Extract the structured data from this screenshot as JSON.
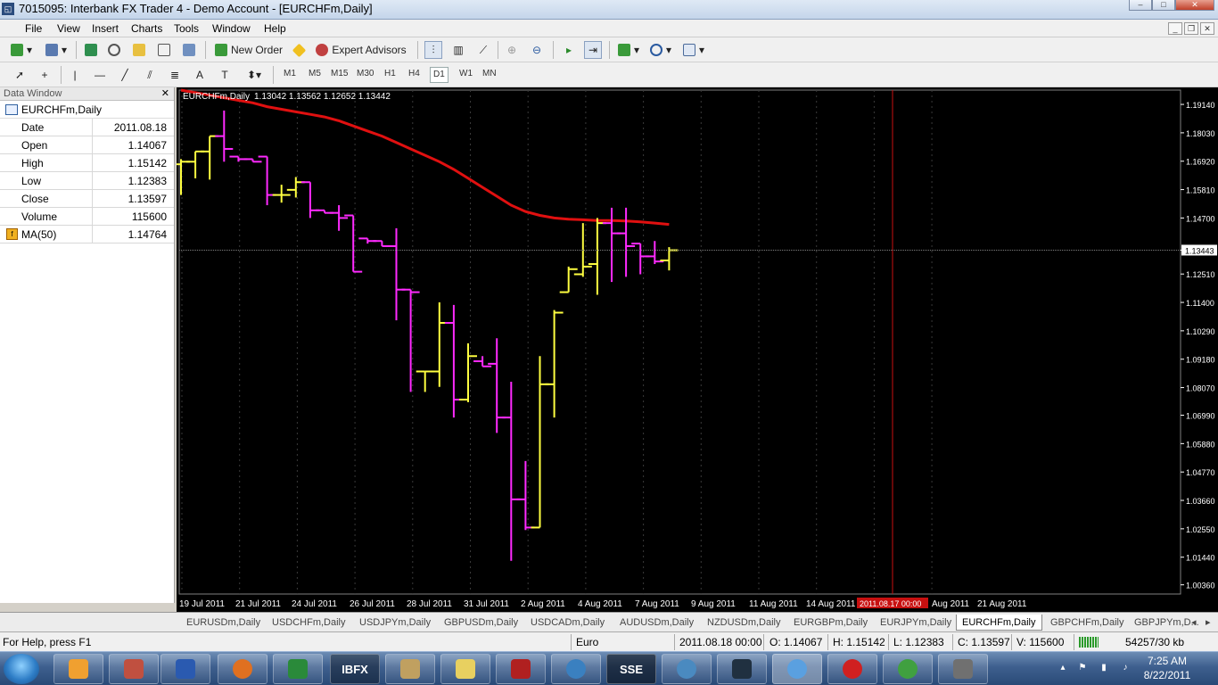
{
  "window": {
    "title": "7015095: Interbank FX Trader 4 - Demo Account - [EURCHFm,Daily]",
    "app_icon": "mt4-icon",
    "controls": [
      "minimize-icon",
      "maximize-icon",
      "close-icon"
    ]
  },
  "menu": {
    "items": [
      "File",
      "View",
      "Insert",
      "Charts",
      "Tools",
      "Window",
      "Help"
    ]
  },
  "toolbar": {
    "new_order": "New Order",
    "expert_advisors": "Expert Advisors"
  },
  "periods": [
    "M1",
    "M5",
    "M15",
    "M30",
    "H1",
    "H4",
    "D1",
    "W1",
    "MN"
  ],
  "active_period": "D1",
  "data_window": {
    "title": "Data Window",
    "symbol": "EURCHFm,Daily",
    "rows": [
      {
        "label": "Date",
        "value": "2011.08.18"
      },
      {
        "label": "Open",
        "value": "1.14067"
      },
      {
        "label": "High",
        "value": "1.15142"
      },
      {
        "label": "Low",
        "value": "1.12383"
      },
      {
        "label": "Close",
        "value": "1.13597"
      },
      {
        "label": "Volume",
        "value": "115600"
      }
    ],
    "indicator": {
      "label": "MA(50)",
      "value": "1.14764"
    }
  },
  "chart_data": {
    "type": "ohlc",
    "title": "EURCHFm,Daily",
    "info": "1.13042 1.13562 1.12652 1.13442",
    "ylim": [
      1.0,
      1.197
    ],
    "price_labels": [
      "1.19140",
      "1.18030",
      "1.16920",
      "1.15810",
      "1.14700",
      "1.13443",
      "1.12510",
      "1.11400",
      "1.10290",
      "1.09180",
      "1.08070",
      "1.06990",
      "1.05880",
      "1.04770",
      "1.03660",
      "1.02550",
      "1.01440",
      "1.00360"
    ],
    "current_price": 1.13443,
    "date_labels": [
      "19 Jul 2011",
      "21 Jul 2011",
      "24 Jul 2011",
      "26 Jul 2011",
      "28 Jul 2011",
      "31 Jul 2011",
      "2 Aug 2011",
      "4 Aug 2011",
      "7 Aug 2011",
      "9 Aug 2011",
      "11 Aug 2011",
      "14 Aug 2011",
      "Aug 2011",
      "21 Aug 2011"
    ],
    "crosshair_label": "2011.08.17 00:00",
    "colors": {
      "up": "#ffff40",
      "down": "#ff2aff",
      "ma": "#e01010",
      "crosshair": "#c81010",
      "grid": "#3a3a3a",
      "axis_text": "#ffffff"
    },
    "bars": [
      {
        "o": 1.168,
        "h": 1.17,
        "l": 1.156,
        "c": 1.169
      },
      {
        "o": 1.169,
        "h": 1.173,
        "l": 1.1625,
        "c": 1.173
      },
      {
        "o": 1.173,
        "h": 1.179,
        "l": 1.162,
        "c": 1.179
      },
      {
        "o": 1.179,
        "h": 1.189,
        "l": 1.169,
        "c": 1.174
      },
      {
        "o": 1.171,
        "h": 1.171,
        "l": 1.169,
        "c": 1.17
      },
      {
        "o": 1.17,
        "h": 1.17,
        "l": 1.169,
        "c": 1.169
      },
      {
        "o": 1.171,
        "h": 1.171,
        "l": 1.152,
        "c": 1.156
      },
      {
        "o": 1.156,
        "h": 1.16,
        "l": 1.153,
        "c": 1.156
      },
      {
        "o": 1.158,
        "h": 1.163,
        "l": 1.155,
        "c": 1.161
      },
      {
        "o": 1.161,
        "h": 1.161,
        "l": 1.147,
        "c": 1.15
      },
      {
        "o": 1.15,
        "h": 1.15,
        "l": 1.149,
        "c": 1.149
      },
      {
        "o": 1.149,
        "h": 1.152,
        "l": 1.142,
        "c": 1.147
      },
      {
        "o": 1.148,
        "h": 1.148,
        "l": 1.126,
        "c": 1.126
      },
      {
        "o": 1.139,
        "h": 1.139,
        "l": 1.137,
        "c": 1.138
      },
      {
        "o": 1.138,
        "h": 1.138,
        "l": 1.136,
        "c": 1.136
      },
      {
        "o": 1.136,
        "h": 1.143,
        "l": 1.107,
        "c": 1.119
      },
      {
        "o": 1.119,
        "h": 1.119,
        "l": 1.079,
        "c": 1.118
      },
      {
        "o": 1.087,
        "h": 1.087,
        "l": 1.079,
        "c": 1.087
      },
      {
        "o": 1.087,
        "h": 1.114,
        "l": 1.081,
        "c": 1.106
      },
      {
        "o": 1.106,
        "h": 1.113,
        "l": 1.069,
        "c": 1.076
      },
      {
        "o": 1.076,
        "h": 1.098,
        "l": 1.075,
        "c": 1.093
      },
      {
        "o": 1.091,
        "h": 1.093,
        "l": 1.089,
        "c": 1.089
      },
      {
        "o": 1.09,
        "h": 1.1,
        "l": 1.063,
        "c": 1.069
      },
      {
        "o": 1.069,
        "h": 1.083,
        "l": 1.013,
        "c": 1.037
      },
      {
        "o": 1.037,
        "h": 1.052,
        "l": 1.025,
        "c": 1.026
      },
      {
        "o": 1.026,
        "h": 1.093,
        "l": 1.026,
        "c": 1.082
      },
      {
        "o": 1.082,
        "h": 1.111,
        "l": 1.069,
        "c": 1.11
      },
      {
        "o": 1.118,
        "h": 1.128,
        "l": 1.118,
        "c": 1.127
      },
      {
        "o": 1.125,
        "h": 1.145,
        "l": 1.124,
        "c": 1.128
      },
      {
        "o": 1.129,
        "h": 1.147,
        "l": 1.117,
        "c": 1.145
      },
      {
        "o": 1.145,
        "h": 1.151,
        "l": 1.122,
        "c": 1.141
      },
      {
        "o": 1.141,
        "h": 1.151,
        "l": 1.124,
        "c": 1.136
      },
      {
        "o": 1.137,
        "h": 1.137,
        "l": 1.125,
        "c": 1.132
      },
      {
        "o": 1.132,
        "h": 1.138,
        "l": 1.129,
        "c": 1.13
      },
      {
        "o": 1.1304,
        "h": 1.1356,
        "l": 1.1265,
        "c": 1.1344
      }
    ],
    "ma": [
      1.197,
      1.196,
      1.195,
      1.194,
      1.193,
      1.192,
      1.1905,
      1.1895,
      1.1885,
      1.1875,
      1.1865,
      1.185,
      1.183,
      1.181,
      1.179,
      1.1765,
      1.174,
      1.1715,
      1.169,
      1.166,
      1.1625,
      1.159,
      1.1555,
      1.152,
      1.1495,
      1.148,
      1.147,
      1.1465,
      1.1463,
      1.146,
      1.146,
      1.1458,
      1.1455,
      1.145,
      1.1445
    ]
  },
  "tabs": [
    "EURUSDm,Daily",
    "USDCHFm,Daily",
    "USDJPYm,Daily",
    "GBPUSDm,Daily",
    "USDCADm,Daily",
    "AUDUSDm,Daily",
    "NZDUSDm,Daily",
    "EURGBPm,Daily",
    "EURJPYm,Daily",
    "EURCHFm,Daily",
    "GBPCHFm,Daily",
    "GBPJPYm,D..."
  ],
  "active_tab": "EURCHFm,Daily",
  "status": {
    "help": "For Help, press F1",
    "profile": "Euro",
    "datetime": "2011.08.18 00:00",
    "open": "O: 1.14067",
    "high": "H: 1.15142",
    "low": "L: 1.12383",
    "close": "C: 1.13597",
    "volume": "V: 115600",
    "traffic": "54257/30 kb"
  },
  "taskbar": {
    "apps": [
      "Outlook",
      "Archive",
      "Word",
      "Firefox",
      "Excel",
      "IBFX",
      "Scanner",
      "Notes",
      "Calculator",
      "Clock",
      "SSE",
      "Bird",
      "Kindle",
      "Twitter",
      "Apple",
      "Disc",
      "Nav"
    ],
    "time": "7:25 AM",
    "date": "8/22/2011"
  }
}
